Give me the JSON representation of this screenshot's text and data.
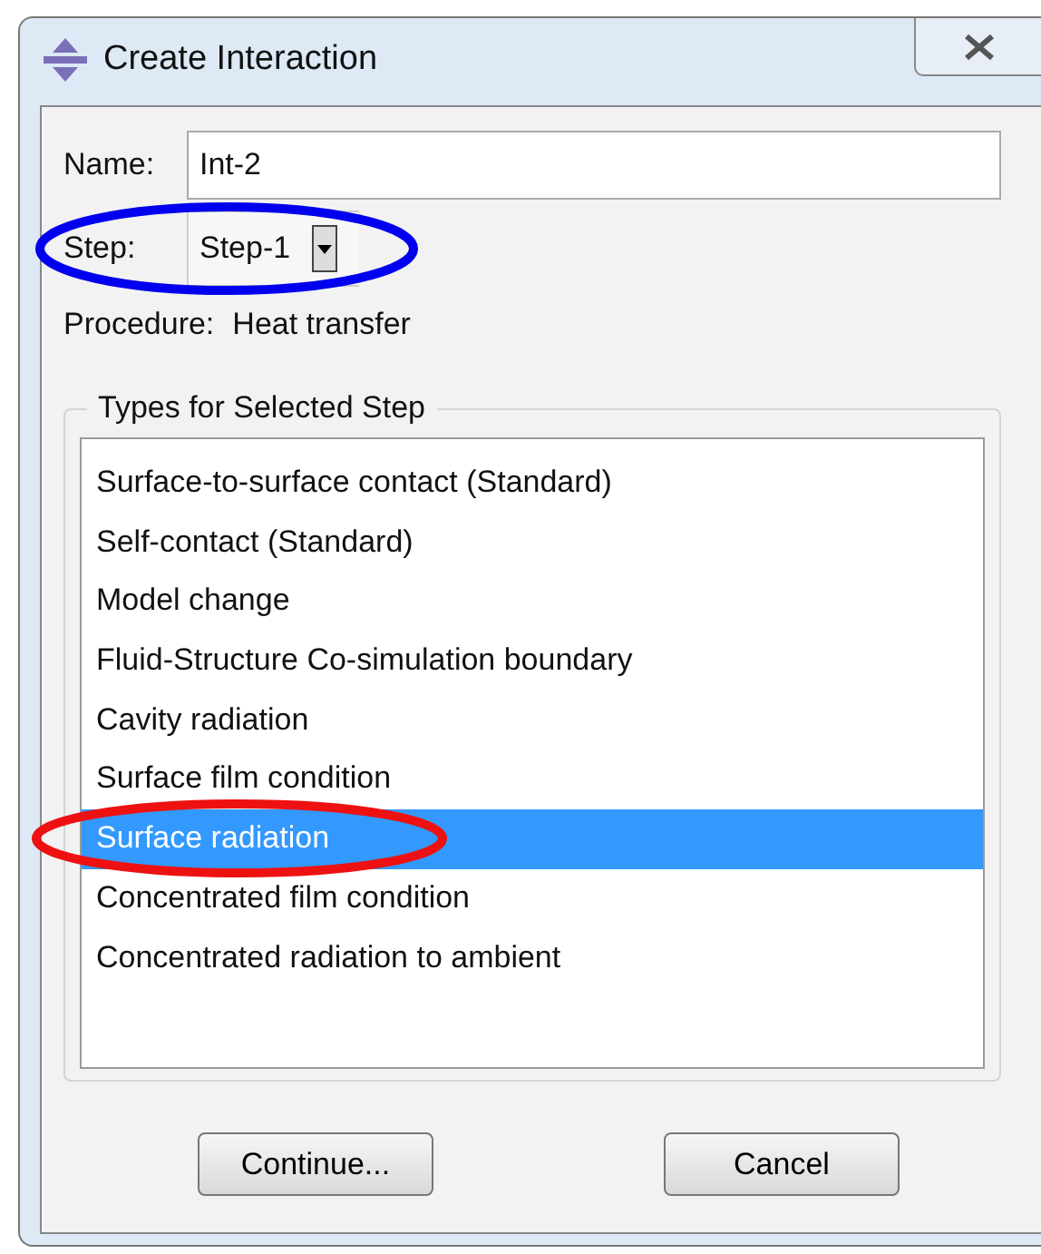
{
  "window": {
    "title": "Create Interaction"
  },
  "name": {
    "label": "Name:",
    "value": "Int-2"
  },
  "step": {
    "label": "Step:",
    "value": "Step-1",
    "circle": {
      "color": "#0000ee"
    }
  },
  "procedure": {
    "label": "Procedure:",
    "value": "Heat transfer"
  },
  "types": {
    "title": "Types for Selected Step",
    "circle": {
      "color": "#ee1111"
    },
    "items": [
      {
        "label": "Surface-to-surface contact (Standard)",
        "selected": false
      },
      {
        "label": "Self-contact (Standard)",
        "selected": false
      },
      {
        "label": "Model change",
        "selected": false
      },
      {
        "label": "Fluid-Structure Co-simulation boundary",
        "selected": false
      },
      {
        "label": "Cavity radiation",
        "selected": false
      },
      {
        "label": "Surface film condition",
        "selected": false
      },
      {
        "label": "Surface radiation",
        "selected": true
      },
      {
        "label": "Concentrated film condition",
        "selected": false
      },
      {
        "label": "Concentrated radiation to ambient",
        "selected": false
      }
    ]
  },
  "buttons": [
    "Continue...",
    "Cancel"
  ]
}
